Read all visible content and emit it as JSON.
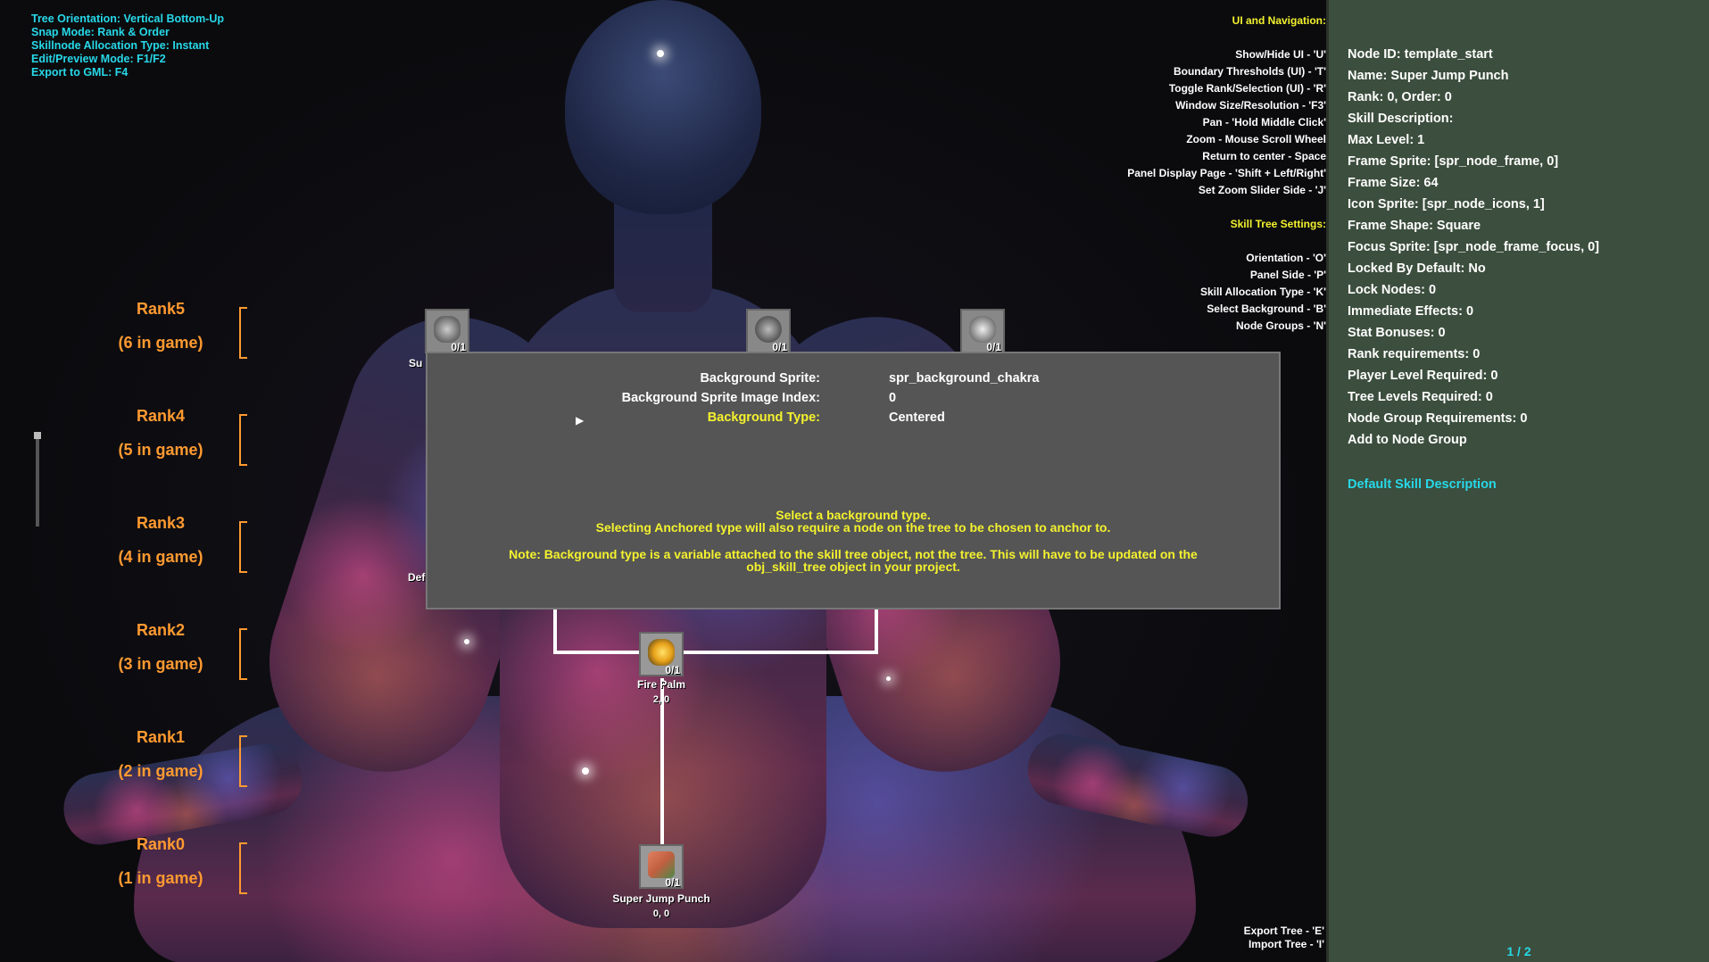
{
  "top_left_info": [
    "Tree Orientation: Vertical Bottom-Up",
    "Snap Mode: Rank & Order",
    "Skillnode Allocation Type: Instant",
    "Edit/Preview Mode: F1/F2",
    "Export to GML: F4"
  ],
  "help": {
    "ui_header": "UI and Navigation:",
    "ui_items": [
      "Show/Hide UI - 'U'",
      "Boundary Thresholds (UI) - 'T'",
      "Toggle Rank/Selection (UI) - 'R'",
      "Window Size/Resolution - 'F3'",
      "Pan - 'Hold Middle Click'",
      "Zoom - Mouse Scroll Wheel",
      "Return to center - Space",
      "Panel Display Page - 'Shift + Left/Right'",
      "Set Zoom Slider Side - 'J'"
    ],
    "settings_header": "Skill Tree Settings:",
    "settings_items": [
      "Orientation - 'O'",
      "Panel Side - 'P'",
      "Skill Allocation Type - 'K'",
      "Select Background - 'B'",
      "Node Groups - 'N'"
    ]
  },
  "ranks": [
    {
      "name": "Rank5",
      "count": "(6 in game)"
    },
    {
      "name": "Rank4",
      "count": "(5 in game)"
    },
    {
      "name": "Rank3",
      "count": "(4 in game)"
    },
    {
      "name": "Rank2",
      "count": "(3 in game)"
    },
    {
      "name": "Rank1",
      "count": "(2 in game)"
    },
    {
      "name": "Rank0",
      "count": "(1 in game)"
    }
  ],
  "nodes": {
    "rank5_a": {
      "count": "0/1",
      "label_partial": "Su"
    },
    "rank5_b": {
      "count": "0/1"
    },
    "rank5_c": {
      "count": "0/1"
    },
    "rank3_label_partial": "Def",
    "fire_palm": {
      "count": "0/1",
      "name": "Fire Palm",
      "pos": "2, 0"
    },
    "super_jump": {
      "count": "0/1",
      "name": "Super Jump Punch",
      "pos": "0, 0"
    }
  },
  "modal": {
    "rows": [
      {
        "label": "Background Sprite:",
        "value": "spr_background_chakra"
      },
      {
        "label": "Background Sprite Image Index:",
        "value": "0"
      },
      {
        "label": "Background Type:",
        "value": "Centered"
      }
    ],
    "help1": "Select a background type.",
    "help2": "Selecting Anchored type will also require a node on the tree to be chosen to anchor to.",
    "note1": "Note: Background type is a variable attached to the skill tree object, not the tree. This will have to be updated on the",
    "note2": "obj_skill_tree object in your project."
  },
  "panel": {
    "props": [
      "Node ID: template_start",
      "Name: Super Jump Punch",
      "Rank: 0, Order: 0",
      "Skill Description:",
      "Max Level: 1",
      "Frame Sprite: [spr_node_frame, 0]",
      "Frame Size: 64",
      "Icon Sprite: [spr_node_icons, 1]",
      "Frame Shape: Square",
      "Focus Sprite: [spr_node_frame_focus, 0]",
      "Locked By Default: No",
      "Lock Nodes: 0",
      "Immediate Effects: 0",
      "Stat Bonuses: 0",
      "Rank requirements: 0",
      "Player Level Required: 0",
      "Tree Levels Required: 0",
      "Node Group Requirements: 0",
      "Add to Node Group"
    ],
    "description": "Default Skill Description",
    "page": "1 / 2"
  },
  "export": [
    "Export Tree - 'E'",
    "Import Tree - 'I'"
  ],
  "colors": {
    "accent_cyan": "#27d8e8",
    "accent_yellow": "#f4f22e",
    "rank_orange": "#ff9a30",
    "panel_green": "#3c4e3d"
  }
}
